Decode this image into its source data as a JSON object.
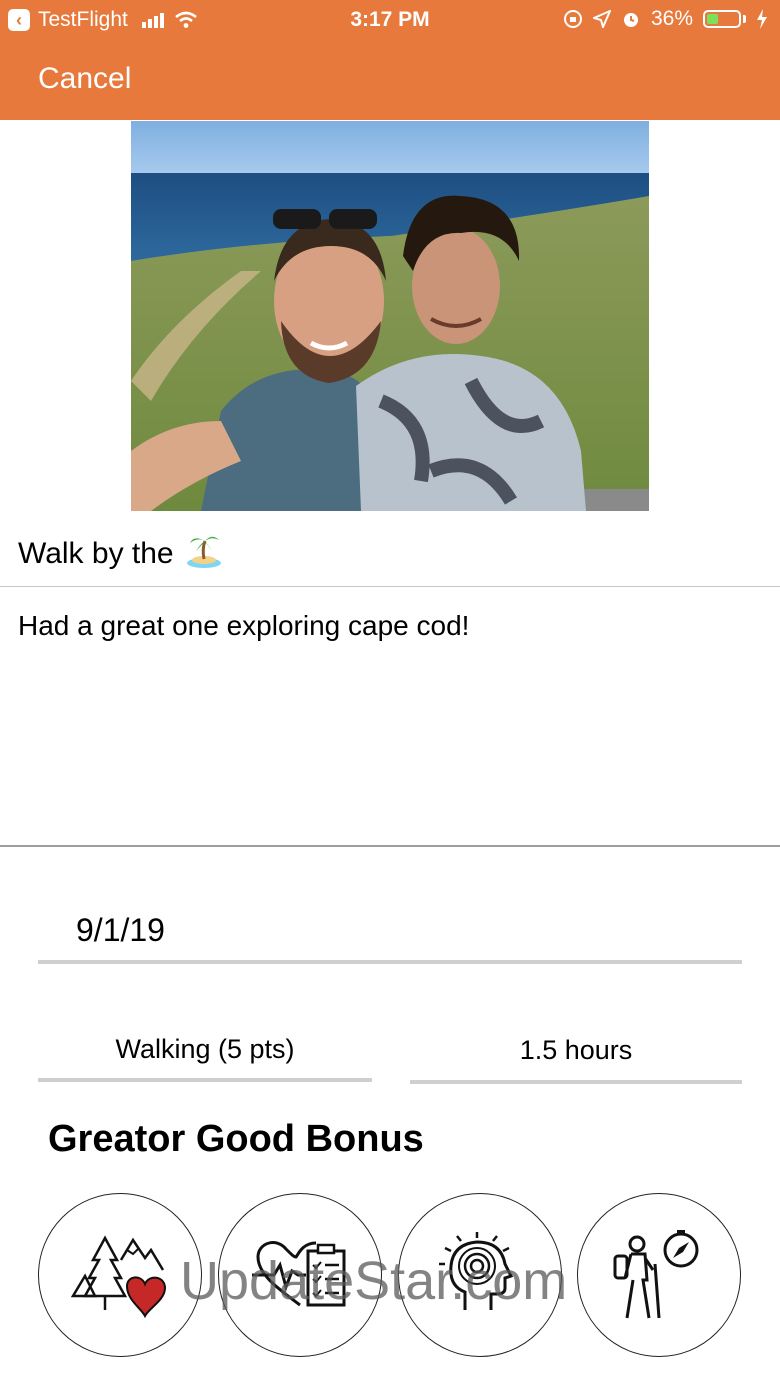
{
  "status_bar": {
    "back_app": "TestFlight",
    "time": "3:17 PM",
    "battery": "36%",
    "battery_level": 0.36
  },
  "nav": {
    "cancel_label": "Cancel"
  },
  "post": {
    "title": "Walk by the",
    "title_emoji": "🏝️",
    "body": "Had a great one exploring cape cod!"
  },
  "form": {
    "date": "9/1/19",
    "activity": "Walking (5 pts)",
    "duration": "1.5 hours"
  },
  "bonus_section": {
    "title": "Greator Good Bonus",
    "items": [
      {
        "icon": "nature-heart-icon"
      },
      {
        "icon": "health-checklist-icon"
      },
      {
        "icon": "mindfulness-icon"
      },
      {
        "icon": "hiker-compass-icon"
      }
    ]
  },
  "watermark": "UpdateStar.com",
  "colors": {
    "header": "#E6793B",
    "battery_fill": "#7DE05A",
    "heart": "#C62828"
  }
}
